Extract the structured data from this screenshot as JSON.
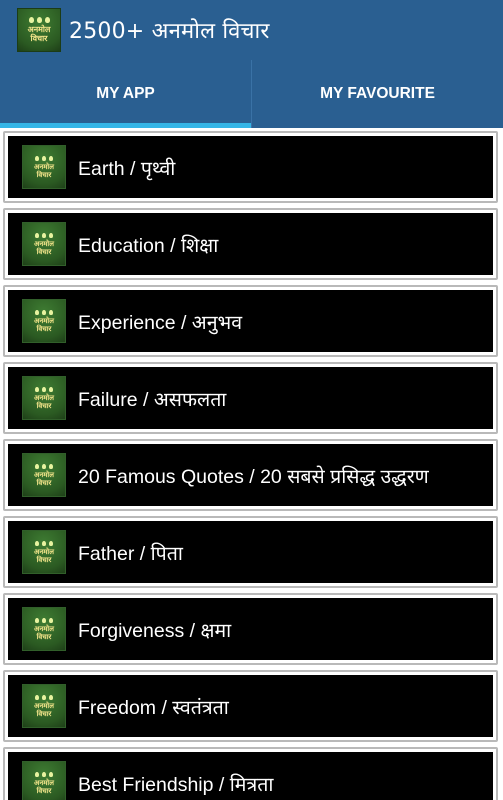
{
  "app": {
    "title": "2500+ अनमोल विचार",
    "logo_text_line1": "अनमोल",
    "logo_text_line2": "विचार"
  },
  "tabs": [
    {
      "label": "MY APP",
      "active": true
    },
    {
      "label": "MY FAVOURITE",
      "active": false
    }
  ],
  "accent_color": "#35b5e6",
  "header_color": "#2a5f91",
  "items": [
    {
      "label": "Earth / पृथ्वी"
    },
    {
      "label": "Education / शिक्षा"
    },
    {
      "label": "Experience / अनुभव"
    },
    {
      "label": "Failure / असफलता"
    },
    {
      "label": "20 Famous Quotes / 20 सबसे प्रसिद्ध उद्धरण"
    },
    {
      "label": "Father / पिता"
    },
    {
      "label": "Forgiveness / क्षमा"
    },
    {
      "label": "Freedom / स्वतंत्रता"
    },
    {
      "label": "Best Friendship / मित्रता"
    }
  ]
}
